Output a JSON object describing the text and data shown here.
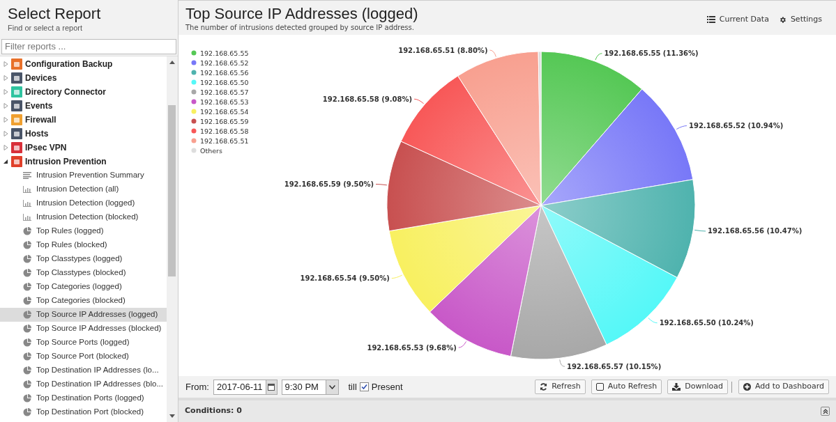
{
  "sidebar": {
    "title": "Select Report",
    "subtitle": "Find or select a report",
    "filter": {
      "placeholder": "Filter reports ..."
    },
    "categories": [
      {
        "label": "Configuration Backup",
        "color": "#e8702a",
        "expanded": false
      },
      {
        "label": "Devices",
        "color": "#4a5568",
        "expanded": false
      },
      {
        "label": "Directory Connector",
        "color": "#2fc4a0",
        "expanded": false
      },
      {
        "label": "Events",
        "color": "#4a5568",
        "expanded": false
      },
      {
        "label": "Firewall",
        "color": "#f0a030",
        "expanded": false
      },
      {
        "label": "Hosts",
        "color": "#4a5568",
        "expanded": false
      },
      {
        "label": "IPsec VPN",
        "color": "#d8303a",
        "expanded": false
      },
      {
        "label": "Intrusion Prevention",
        "color": "#e0402a",
        "expanded": true,
        "children": [
          {
            "label": "Intrusion Prevention Summary",
            "kind": "summary",
            "selected": false
          },
          {
            "label": "Intrusion Detection (all)",
            "kind": "bar",
            "selected": false
          },
          {
            "label": "Intrusion Detection (logged)",
            "kind": "bar",
            "selected": false
          },
          {
            "label": "Intrusion Detection (blocked)",
            "kind": "bar",
            "selected": false
          },
          {
            "label": "Top Rules (logged)",
            "kind": "pie",
            "selected": false
          },
          {
            "label": "Top Rules (blocked)",
            "kind": "pie",
            "selected": false
          },
          {
            "label": "Top Classtypes (logged)",
            "kind": "pie",
            "selected": false
          },
          {
            "label": "Top Classtypes (blocked)",
            "kind": "pie",
            "selected": false
          },
          {
            "label": "Top Categories (logged)",
            "kind": "pie",
            "selected": false
          },
          {
            "label": "Top Categories (blocked)",
            "kind": "pie",
            "selected": false
          },
          {
            "label": "Top Source IP Addresses (logged)",
            "kind": "pie",
            "selected": true
          },
          {
            "label": "Top Source IP Addresses (blocked)",
            "kind": "pie",
            "selected": false
          },
          {
            "label": "Top Source Ports (logged)",
            "kind": "pie",
            "selected": false
          },
          {
            "label": "Top Source Port (blocked)",
            "kind": "pie",
            "selected": false
          },
          {
            "label": "Top Destination IP Addresses (lo...",
            "kind": "pie",
            "selected": false
          },
          {
            "label": "Top Destination IP Addresses (blo...",
            "kind": "pie",
            "selected": false
          },
          {
            "label": "Top Destination Ports (logged)",
            "kind": "pie",
            "selected": false
          },
          {
            "label": "Top Destination Port (blocked)",
            "kind": "pie",
            "selected": false
          }
        ]
      }
    ]
  },
  "report": {
    "title": "Top Source IP Addresses (logged)",
    "subtitle": "The number of intrusions detected grouped by source IP address.",
    "actions": [
      {
        "label": "Current Data",
        "kind": "list"
      },
      {
        "label": "Settings",
        "kind": "gear"
      }
    ],
    "chart_data": {
      "type": "pie",
      "categories": [
        "192.168.65.55",
        "192.168.65.52",
        "192.168.65.56",
        "192.168.65.50",
        "192.168.65.57",
        "192.168.65.53",
        "192.168.65.54",
        "192.168.65.59",
        "192.168.65.58",
        "192.168.65.51",
        "Others"
      ],
      "values": [
        11.36,
        10.94,
        10.47,
        10.24,
        10.15,
        9.68,
        9.5,
        9.5,
        9.08,
        8.8,
        0.28
      ],
      "legend": "left",
      "colors": [
        "#55c855",
        "#7878f8",
        "#4fb3ae",
        "#55f8f8",
        "#a8a8a8",
        "#c858c8",
        "#f8f060",
        "#c85050",
        "#f85858",
        "#f8a090",
        "#dddddd"
      ],
      "value_labels": [
        "192.168.65.55 (11.36%)",
        "192.168.65.52 (10.94%)",
        "192.168.65.56 (10.47%)",
        "192.168.65.50 (10.24%)",
        "192.168.65.57 (10.15%)",
        "192.168.65.53 (9.68%)",
        "192.168.65.54 (9.50%)",
        "192.168.65.59 (9.50%)",
        "192.168.65.58 (9.08%)",
        "192.168.65.51 (8.80%)",
        null
      ]
    },
    "toolbar": {
      "from_label": "From:",
      "date": "2017-06-11",
      "time": "9:30 PM",
      "till_label": "till",
      "present": {
        "label": "Present",
        "checked": true
      },
      "buttons": [
        {
          "label": "Refresh",
          "kind": "refresh"
        },
        {
          "label": "Auto Refresh",
          "kind": "checkbox"
        },
        {
          "label": "Download",
          "kind": "download"
        },
        {
          "label": "Add to Dashboard",
          "kind": "add"
        }
      ]
    },
    "conditions": {
      "label": "Conditions: 0"
    }
  }
}
